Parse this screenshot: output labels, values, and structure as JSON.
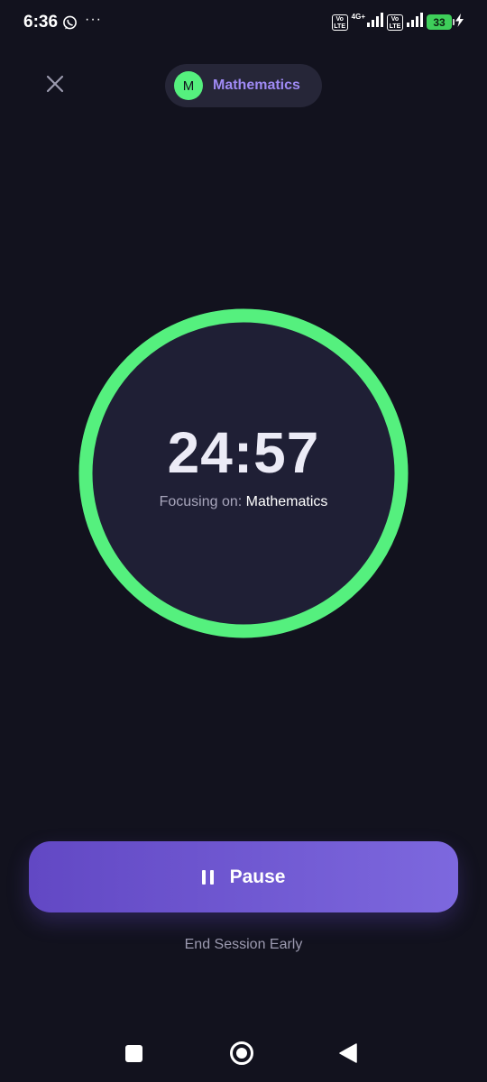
{
  "status_bar": {
    "time": "6:36",
    "more": "···",
    "volte_label": "Vo LTE",
    "network_type": "4G+",
    "battery_level": "33",
    "icons": [
      "whatsapp-icon",
      "volte-icon",
      "signal-icon",
      "battery-icon",
      "charging-icon"
    ]
  },
  "header": {
    "close_icon": "close-icon",
    "subject_initial": "M",
    "subject_name": "Mathematics"
  },
  "timer": {
    "value": "24:57",
    "focus_prefix": "Focusing on:",
    "focus_subject": "Mathematics",
    "ring_color": "#55f07e",
    "progress_fraction": 1.0
  },
  "actions": {
    "pause_label": "Pause",
    "pause_icon": "pause-icon",
    "end_session_label": "End Session Early"
  },
  "nav_bar": {
    "icons": [
      "recents-icon",
      "home-icon",
      "back-icon"
    ]
  },
  "colors": {
    "background": "#12121e",
    "accent_green": "#55f07e",
    "accent_purple": "#6f58d4",
    "chip_text": "#9f8af4"
  }
}
